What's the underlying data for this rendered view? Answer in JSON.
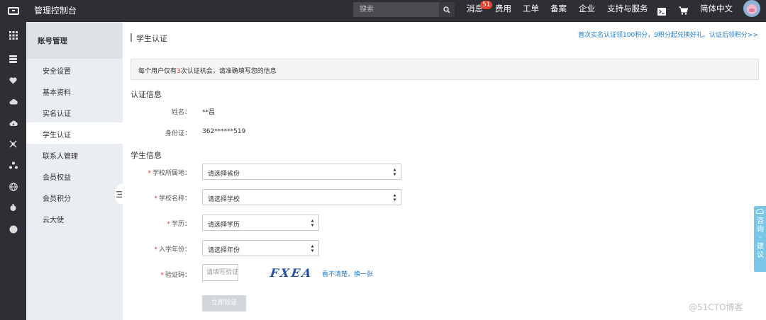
{
  "topbar": {
    "console_title": "管理控制台",
    "search_placeholder": "搜索",
    "nav": {
      "messages": "消息",
      "messages_badge": "51",
      "fees": "费用",
      "tickets": "工单",
      "filing": "备案",
      "enterprise": "企业",
      "support": "支持与服务",
      "language": "简体中文"
    }
  },
  "rail": {
    "icons": [
      "grid-icon",
      "database-icon",
      "heart-icon",
      "cloud-icon",
      "cloud-upload-icon",
      "network-icon",
      "cluster-icon",
      "globe-icon",
      "bulb-icon",
      "circle-icon"
    ]
  },
  "sidebar": {
    "header": "账号管理",
    "items": [
      {
        "label": "安全设置"
      },
      {
        "label": "基本资料"
      },
      {
        "label": "实名认证"
      },
      {
        "label": "学生认证"
      },
      {
        "label": "联系人管理"
      },
      {
        "label": "会员权益"
      },
      {
        "label": "会员积分"
      },
      {
        "label": "云大使"
      }
    ],
    "active_index": 3
  },
  "main": {
    "title": "学生认证",
    "promo": "首次实名认证领100积分，9积分起兑换好礼。认证后领积分>>",
    "notice": {
      "before": "每个用户仅有",
      "highlight": "3",
      "after": "次认证机会，请准确填写您的信息"
    },
    "auth_section": {
      "title": "认证信息",
      "name_label": "姓名：",
      "name_value": "**昌",
      "id_label": "身份证：",
      "id_value": "362******519"
    },
    "student_section": {
      "title": "学生信息",
      "region_label": "学校所属地：",
      "region_value": "请选择省份",
      "school_label": "学校名称：",
      "school_value": "请选择学校",
      "degree_label": "学历：",
      "degree_value": "请选择学历",
      "year_label": "入学年份：",
      "year_value": "请选择年份",
      "captcha_label": "验证码：",
      "captcha_placeholder": "请填写验证码",
      "captcha_image_text": "FXEA",
      "captcha_refresh": "看不清楚，换一张",
      "submit": "立即验证"
    }
  },
  "consult": {
    "text": "咨询·建议"
  },
  "watermark": "@51CTO博客"
}
